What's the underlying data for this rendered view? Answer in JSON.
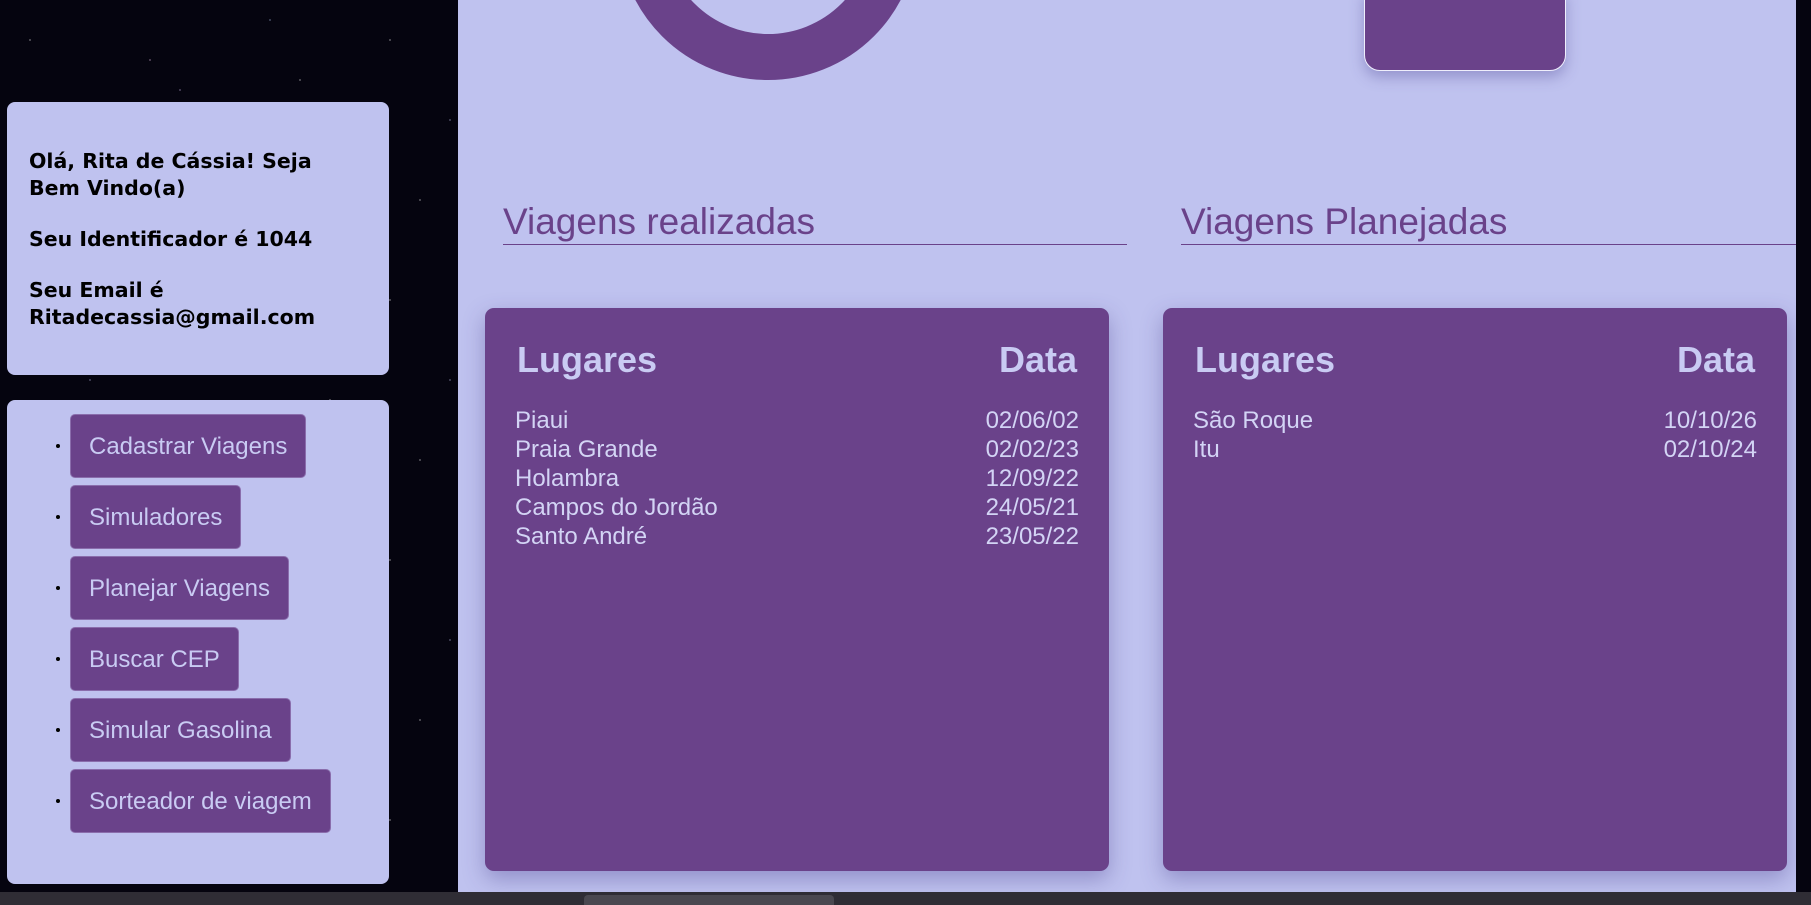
{
  "user": {
    "greeting": "Olá, Rita de Cássia! Seja Bem Vindo(a)",
    "identifier": "Seu Identificador é 1044",
    "email_label": "Seu Email é",
    "email": "Ritadecassia@gmail.com"
  },
  "menu": {
    "items": [
      {
        "label": "Cadastrar Viagens"
      },
      {
        "label": "Simuladores"
      },
      {
        "label": "Planejar Viagens"
      },
      {
        "label": "Buscar CEP"
      },
      {
        "label": "Simular Gasolina"
      },
      {
        "label": "Sorteador de viagem"
      }
    ]
  },
  "completed": {
    "title": "Viagens realizadas",
    "headers": {
      "place": "Lugares",
      "date": "Data"
    },
    "rows": [
      {
        "place": "Piaui",
        "date": "02/06/02"
      },
      {
        "place": "Praia Grande",
        "date": "02/02/23"
      },
      {
        "place": "Holambra",
        "date": "12/09/22"
      },
      {
        "place": "Campos do Jordão",
        "date": "24/05/21"
      },
      {
        "place": "Santo André",
        "date": "23/05/22"
      }
    ]
  },
  "planned": {
    "title": "Viagens Planejadas",
    "headers": {
      "place": "Lugares",
      "date": "Data"
    },
    "rows": [
      {
        "place": "São Roque",
        "date": "10/10/26"
      },
      {
        "place": "Itu",
        "date": "02/10/24"
      }
    ]
  },
  "colors": {
    "accent": "#6a428a",
    "panel": "#bfc2ef",
    "button_text": "#c9cbf3",
    "background": "#05040f"
  }
}
